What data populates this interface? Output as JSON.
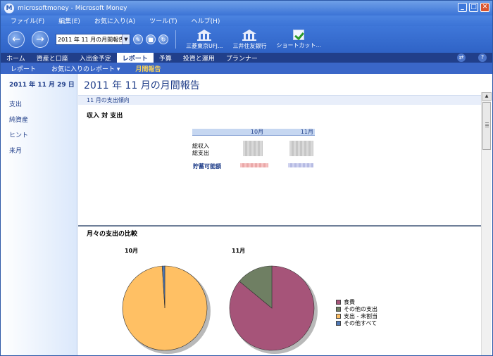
{
  "window": {
    "title": "microsoftmoney - Microsoft Money",
    "app_icon": "M"
  },
  "menu": [
    "ファイル(F)",
    "編集(E)",
    "お気に入り(A)",
    "ツール(T)",
    "ヘルプ(H)"
  ],
  "toolbar": {
    "address_value": "2011 年 11 月の月間報告",
    "shortcuts": [
      {
        "label": "三菱東京UFJ...",
        "icon": "bank-icon"
      },
      {
        "label": "三井住友銀行",
        "icon": "bank-icon"
      },
      {
        "label": "ショートカット...",
        "icon": "checkbox-icon"
      }
    ]
  },
  "tabs": [
    "ホーム",
    "資産と口座",
    "入出金予定",
    "レポート",
    "予算",
    "投資と運用",
    "プランナー"
  ],
  "active_tab": "レポート",
  "subnav": [
    "レポート",
    "お気に入りのレポート ▾",
    "月間報告"
  ],
  "sidebar": {
    "date": "2011 年 11 月 29 日",
    "links": [
      "支出",
      "純資産",
      "ヒント",
      "来月"
    ]
  },
  "content": {
    "page_title": "2011 年 11 月の月間報告",
    "section_title": "11 月の支出傾向",
    "income_vs_expense": {
      "title": "収入 対 支出",
      "columns": [
        "10月",
        "11月"
      ],
      "rows": [
        "総収入",
        "総支出"
      ],
      "savings_label": "貯蓄可能額"
    },
    "comparison_title": "月々の支出の比較"
  },
  "chart_data": {
    "type": "pie",
    "title": "",
    "legend": [
      {
        "name": "食費",
        "color": "#a65479"
      },
      {
        "name": "その他の支出",
        "color": "#6f7f63"
      },
      {
        "name": "支出 - 未割当",
        "color": "#ffc064"
      },
      {
        "name": "その他すべて",
        "color": "#4f79b6"
      }
    ],
    "legend_position": "right",
    "pies": [
      {
        "name": "10月",
        "slices": [
          {
            "label": "食費",
            "value": 0
          },
          {
            "label": "その他の支出",
            "value": 0
          },
          {
            "label": "支出 - 未割当",
            "value": 99
          },
          {
            "label": "その他すべて",
            "value": 1
          }
        ]
      },
      {
        "name": "11月",
        "slices": [
          {
            "label": "食費",
            "value": 86
          },
          {
            "label": "その他の支出",
            "value": 14
          },
          {
            "label": "支出 - 未割当",
            "value": 0
          },
          {
            "label": "その他すべて",
            "value": 0
          }
        ]
      }
    ]
  }
}
